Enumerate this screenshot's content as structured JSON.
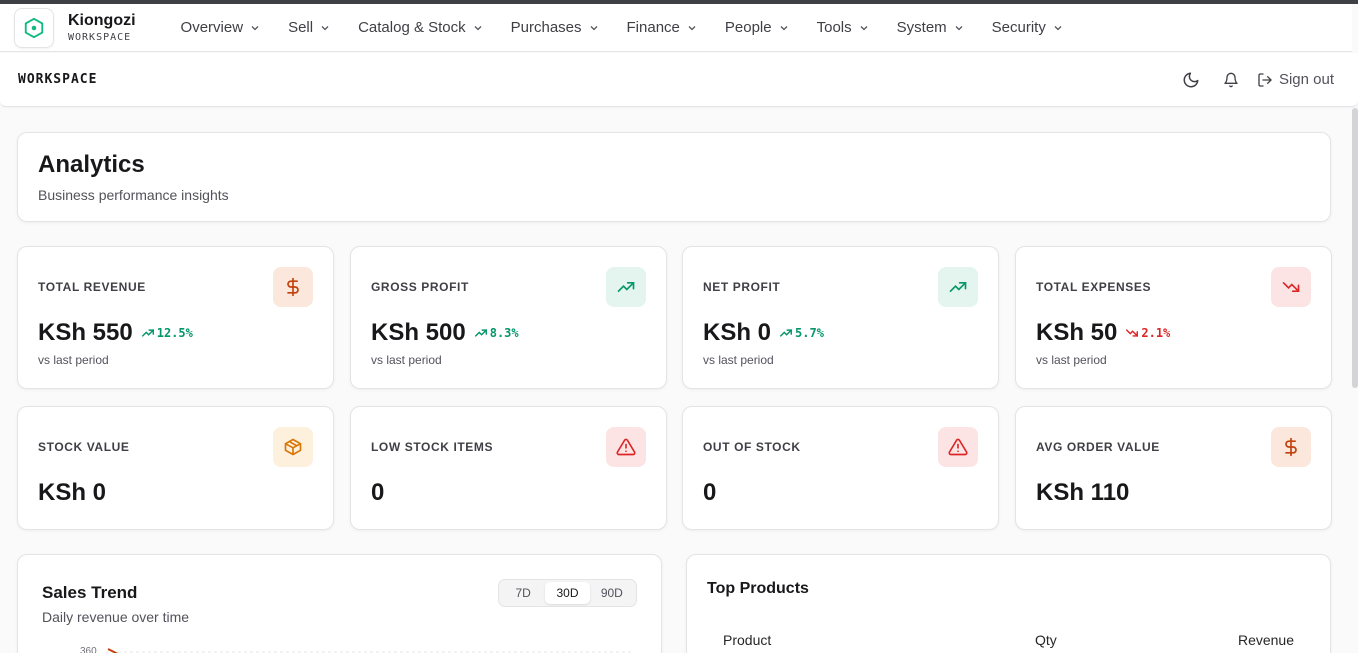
{
  "brand": {
    "name": "Kiongozi",
    "subtitle": "WORKSPACE"
  },
  "nav": {
    "items": [
      {
        "label": "Overview"
      },
      {
        "label": "Sell"
      },
      {
        "label": "Catalog & Stock"
      },
      {
        "label": "Purchases"
      },
      {
        "label": "Finance"
      },
      {
        "label": "People"
      },
      {
        "label": "Tools"
      },
      {
        "label": "System"
      },
      {
        "label": "Security"
      }
    ]
  },
  "subbar": {
    "title": "WORKSPACE",
    "signout_label": "Sign out"
  },
  "page": {
    "title": "Analytics",
    "subtitle": "Business performance insights"
  },
  "kpis": [
    {
      "label": "TOTAL REVENUE",
      "value": "KSh 550",
      "change": "12.5%",
      "note": "vs last period",
      "icon": "dollar-icon",
      "trend": "up"
    },
    {
      "label": "GROSS PROFIT",
      "value": "KSh 500",
      "change": "8.3%",
      "note": "vs last period",
      "icon": "trending-up-icon",
      "trend": "up"
    },
    {
      "label": "NET PROFIT",
      "value": "KSh 0",
      "change": "5.7%",
      "note": "vs last period",
      "icon": "trending-up-icon",
      "trend": "up"
    },
    {
      "label": "TOTAL EXPENSES",
      "value": "KSh 50",
      "change": "2.1%",
      "note": "vs last period",
      "icon": "trending-down-icon",
      "trend": "down"
    },
    {
      "label": "STOCK VALUE",
      "value": "KSh 0",
      "icon": "box-icon"
    },
    {
      "label": "LOW STOCK ITEMS",
      "value": "0",
      "icon": "alert-triangle-icon"
    },
    {
      "label": "OUT OF STOCK",
      "value": "0",
      "icon": "alert-triangle-icon"
    },
    {
      "label": "AVG ORDER VALUE",
      "value": "KSh 110",
      "icon": "dollar-icon"
    }
  ],
  "sales_trend": {
    "title": "Sales Trend",
    "subtitle": "Daily revenue over time",
    "ranges": [
      "7D",
      "30D",
      "90D"
    ],
    "selected_range": "30D",
    "y_tick_top": "360"
  },
  "top_products": {
    "title": "Top Products",
    "columns": [
      "Product",
      "Qty",
      "Revenue"
    ]
  },
  "colors": {
    "accent_green": "#059669",
    "accent_red": "#dc2626",
    "accent_orange": "#c2410c",
    "accent_amber": "#d97706",
    "brand_teal": "#10b981"
  }
}
